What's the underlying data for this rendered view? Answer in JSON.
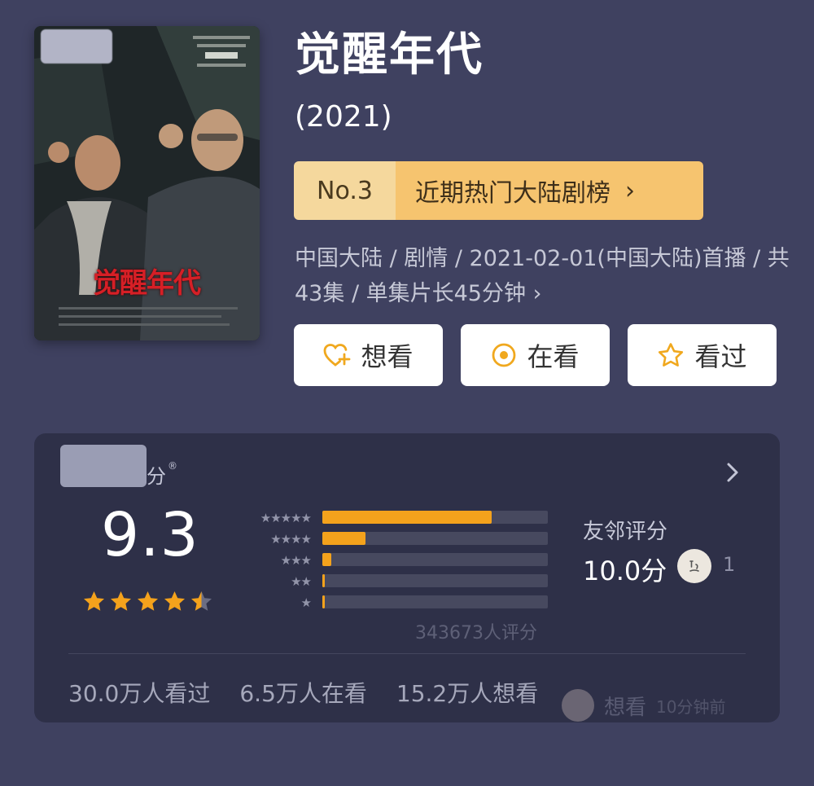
{
  "title": "觉醒年代",
  "year": "(2021)",
  "poster": {
    "title_text": "觉醒年代"
  },
  "rank": {
    "number": "No.3",
    "label": "近期热门大陆剧榜",
    "chevron": "›"
  },
  "meta": {
    "text": "中国大陆 / 剧情 / 2021-02-01(中国大陆)首播 / 共43集 / 单集片长45分钟",
    "chevron": "›"
  },
  "actions": [
    {
      "label": "想看",
      "icon": "heart-plus-icon"
    },
    {
      "label": "在看",
      "icon": "target-icon"
    },
    {
      "label": "看过",
      "icon": "star-outline-icon"
    }
  ],
  "rating": {
    "brand_suffix": "分",
    "registered": "®",
    "score": "9.3",
    "stars_value": 4.5,
    "stars_max": 5,
    "distribution": [
      {
        "stars": "★★★★★",
        "fraction": 0.75
      },
      {
        "stars": "★★★★",
        "fraction": 0.19
      },
      {
        "stars": "★★★",
        "fraction": 0.04
      },
      {
        "stars": "★★",
        "fraction": 0.005
      },
      {
        "stars": "★",
        "fraction": 0.005
      }
    ],
    "count_text": "343673人评分",
    "friend_label": "友邻评分",
    "friend_score": "10.0分",
    "friend_count": "1",
    "stats": [
      "30.0万人看过",
      "6.5万人在看",
      "15.2万人想看"
    ]
  },
  "watermark": {
    "text": "想看",
    "time": "10分钟前"
  },
  "colors": {
    "background": "#3f4160",
    "card": "#2e3048",
    "accent": "#f4a21c",
    "rank_left": "#f5d89d",
    "rank_right": "#f6c46f",
    "icon_accent": "#f0a81e"
  }
}
